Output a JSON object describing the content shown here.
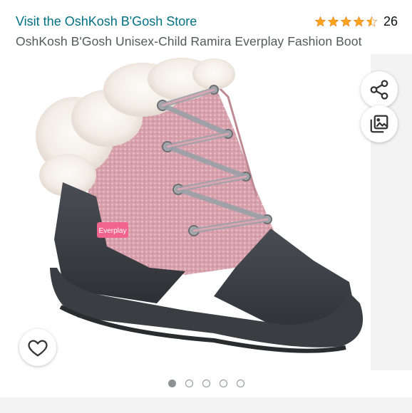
{
  "header": {
    "store_link": "Visit the OshKosh B'Gosh Store",
    "rating": {
      "stars": 4.5,
      "max_stars": 5,
      "count": "26"
    },
    "product_title": "OshKosh B'Gosh Unisex-Child Ramira Everplay Fashion Boot"
  },
  "product_image": {
    "description_label": "Everplay",
    "alt": "pink glitter boot with faux fur collar"
  },
  "gallery_actions": {
    "share_icon": "share-icon",
    "view_in_room_icon": "image-viewer-icon",
    "wishlist_icon": "heart-icon"
  },
  "carousel": {
    "total": 5,
    "active_index": 0
  },
  "colors": {
    "link": "#007185",
    "star": "#ffa41c",
    "title": "#565959"
  }
}
